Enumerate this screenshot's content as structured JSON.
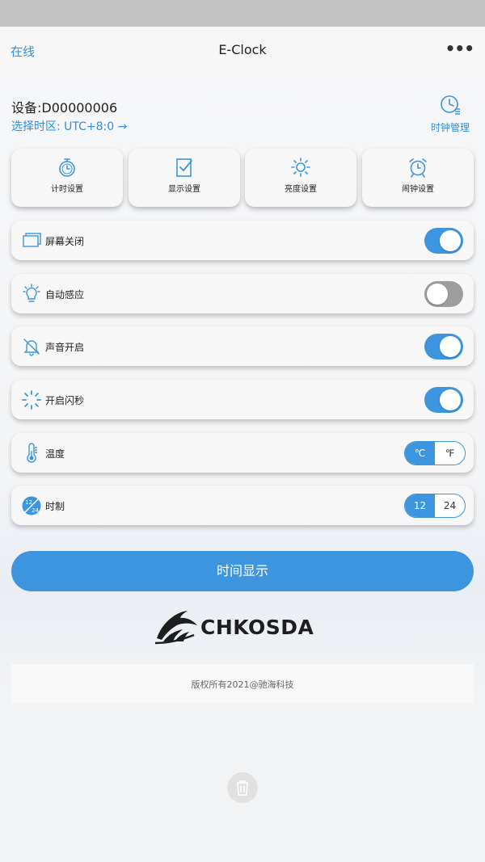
{
  "nav": {
    "status": "在线",
    "title": "E-Clock",
    "more_icon": "more-dots-icon"
  },
  "device": {
    "name": "设备:D00000006",
    "timezone_link": "选择时区: UTC+8:0 →",
    "clock_manage_label": "时钟管理"
  },
  "tiles": [
    {
      "label": "计时设置",
      "icon": "stopwatch-icon"
    },
    {
      "label": "显示设置",
      "icon": "display-check-icon"
    },
    {
      "label": "亮度设置",
      "icon": "brightness-icon"
    },
    {
      "label": "闹钟设置",
      "icon": "alarm-clock-icon"
    }
  ],
  "settings": [
    {
      "label": "屏幕关闭",
      "icon": "screen-icon",
      "toggle": true
    },
    {
      "label": "自动感应",
      "icon": "light-bulb-icon",
      "toggle": false
    },
    {
      "label": "声音开启",
      "icon": "bell-off-icon",
      "toggle": true
    },
    {
      "label": "开启闪秒",
      "icon": "loading-dots-icon",
      "toggle": true
    }
  ],
  "temperature": {
    "label": "温度",
    "icon": "thermometer-icon",
    "options": [
      "℃",
      "℉"
    ],
    "selected": "℃"
  },
  "hour_format": {
    "label": "时制",
    "icon": "12-24-icon",
    "options": [
      "12",
      "24"
    ],
    "selected": "12"
  },
  "primary_button": "时间显示",
  "brand": "CHKOSDA",
  "copyright": "版权所有2021@驰海科技",
  "colors": {
    "accent": "#3d95e0",
    "toggle_off": "#9d9d9d",
    "status_bar": "#c3c3c3"
  }
}
